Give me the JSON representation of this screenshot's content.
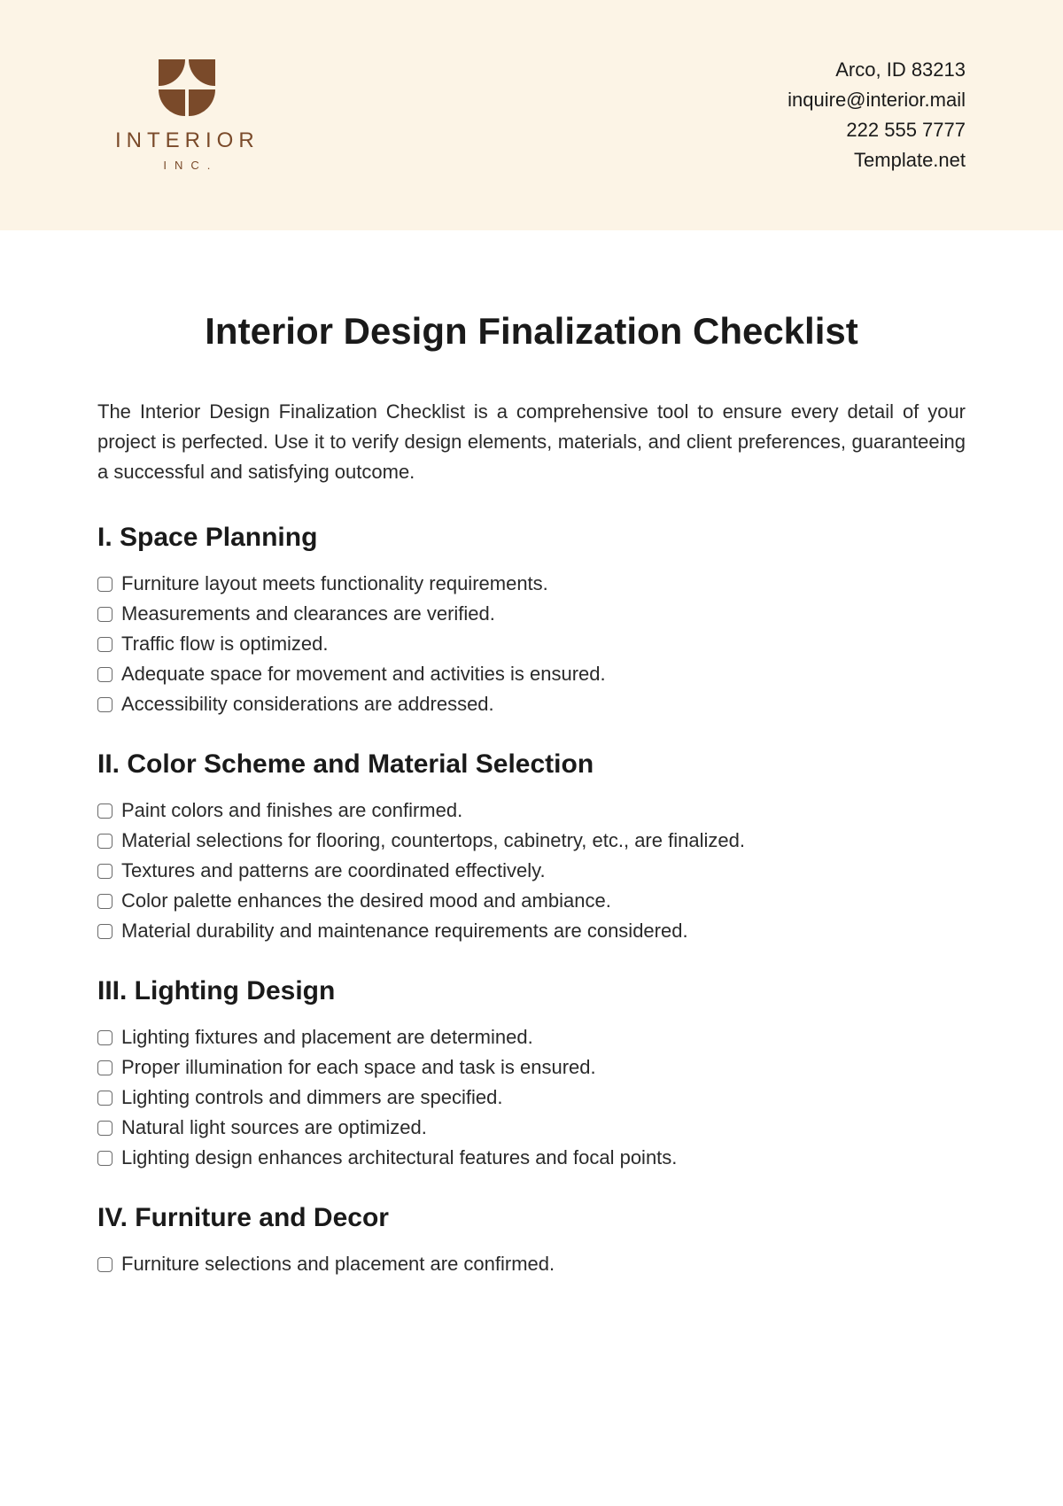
{
  "header": {
    "logo_name": "INTERIOR",
    "logo_sub": "INC.",
    "contact": {
      "address": "Arco, ID 83213",
      "email": "inquire@interior.mail",
      "phone": "222 555 7777",
      "site": "Template.net"
    }
  },
  "main": {
    "title": "Interior Design Finalization Checklist",
    "intro": "The Interior Design Finalization Checklist is a comprehensive tool to ensure every detail of your project is perfected. Use it to verify design elements, materials, and client preferences, guaranteeing a successful and satisfying outcome."
  },
  "sections": [
    {
      "heading": "I. Space Planning",
      "items": [
        "Furniture layout meets functionality requirements.",
        "Measurements and clearances are verified.",
        "Traffic flow is optimized.",
        "Adequate space for movement and activities is ensured.",
        "Accessibility considerations are addressed."
      ]
    },
    {
      "heading": "II. Color Scheme and Material Selection",
      "items": [
        "Paint colors and finishes are confirmed.",
        "Material selections for flooring, countertops, cabinetry, etc., are finalized.",
        "Textures and patterns are coordinated effectively.",
        "Color palette enhances the desired mood and ambiance.",
        "Material durability and maintenance requirements are considered."
      ]
    },
    {
      "heading": "III. Lighting Design",
      "items": [
        "Lighting fixtures and placement are determined.",
        "Proper illumination for each space and task is ensured.",
        "Lighting controls and dimmers are specified.",
        "Natural light sources are optimized.",
        "Lighting design enhances architectural features and focal points."
      ]
    },
    {
      "heading": "IV. Furniture and Decor",
      "items": [
        "Furniture selections and placement are confirmed."
      ]
    }
  ]
}
